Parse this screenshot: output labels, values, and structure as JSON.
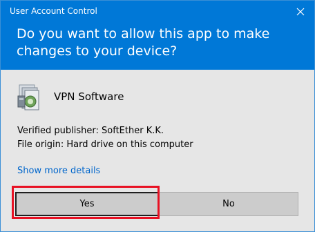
{
  "window": {
    "title": "User Account Control",
    "close_icon": "close-icon"
  },
  "prompt": {
    "question": "Do you want to allow this app to make changes to your device?"
  },
  "app": {
    "icon": "vpn-software-icon",
    "name": "VPN Software"
  },
  "details": {
    "publisher": "Verified publisher: SoftEther K.K.",
    "origin": "File origin: Hard drive on this computer",
    "show_more": "Show more details"
  },
  "buttons": {
    "yes": "Yes",
    "no": "No"
  },
  "colors": {
    "header_bg": "#0078d7",
    "body_bg": "#e6e6e6",
    "link": "#0066cc",
    "highlight": "#e81123"
  }
}
